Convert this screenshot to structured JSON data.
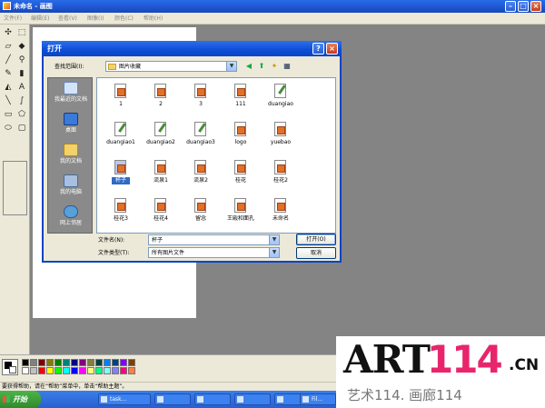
{
  "window": {
    "title": "未命名 - 画图"
  },
  "menu": [
    "文件(F)",
    "编辑(E)",
    "查看(V)",
    "图像(I)",
    "颜色(C)",
    "帮助(H)"
  ],
  "dialog": {
    "title": "打开",
    "look_in_label": "查找范围(I):",
    "look_in_value": "图片收藏",
    "places": [
      "我最近的文档",
      "桌面",
      "我的文档",
      "我的电脑",
      "网上邻居"
    ],
    "files": [
      "1",
      "2",
      "3",
      "111",
      "duangiao",
      "duangiao1",
      "duangiao2",
      "duangiao3",
      "logo",
      "yuebao",
      "杯子",
      "流泉1",
      "流泉2",
      "桂花",
      "桂花2",
      "桂花3",
      "桂花4",
      "留念",
      "王殿和面孔",
      "未命名"
    ],
    "selected_file": "杯子",
    "filename_label": "文件名(N):",
    "filename_value": "杯子",
    "filetype_label": "文件类型(T):",
    "filetype_value": "所有图片文件",
    "open_button": "打开(O)",
    "cancel_button": "取消"
  },
  "status": "要获得帮助，请在“帮助”菜单中，单击“帮助主题”。",
  "taskbar": {
    "start": "开始",
    "items": [
      "task...",
      "",
      "",
      "",
      "",
      "Fil..."
    ]
  },
  "watermark": {
    "art": "ART",
    "num": "114",
    "cn": ".CN",
    "sub": "艺术114. 画廊114"
  },
  "colors": {
    "palette_row1": [
      "#000000",
      "#808080",
      "#800000",
      "#808000",
      "#008000",
      "#008080",
      "#000080",
      "#800080",
      "#808040",
      "#004040",
      "#0080ff",
      "#004080",
      "#8000ff",
      "#804000"
    ],
    "palette_row2": [
      "#ffffff",
      "#c0c0c0",
      "#ff0000",
      "#ffff00",
      "#00ff00",
      "#00ffff",
      "#0000ff",
      "#ff00ff",
      "#ffff80",
      "#00ff80",
      "#80ffff",
      "#8080ff",
      "#ff0080",
      "#ff8040"
    ]
  }
}
